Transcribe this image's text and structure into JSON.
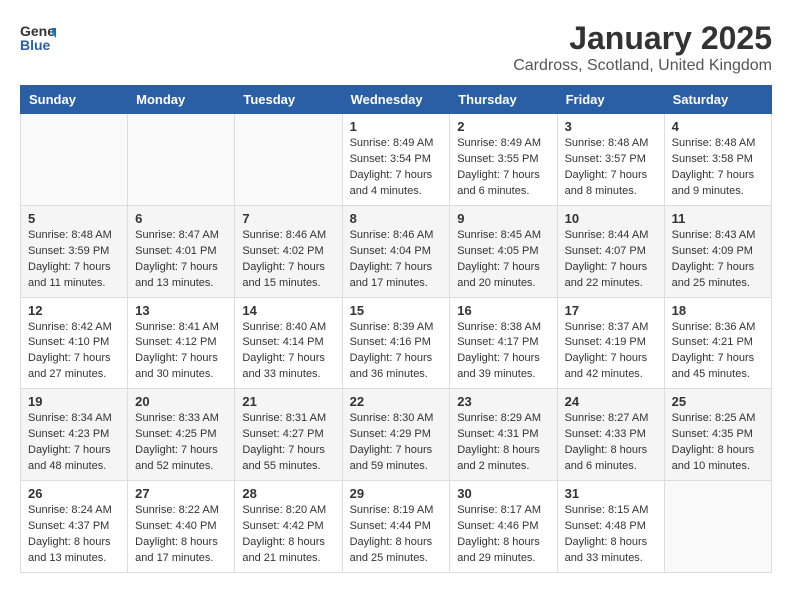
{
  "logo": {
    "text_general": "General",
    "text_blue": "Blue"
  },
  "header": {
    "month": "January 2025",
    "location": "Cardross, Scotland, United Kingdom"
  },
  "weekdays": [
    "Sunday",
    "Monday",
    "Tuesday",
    "Wednesday",
    "Thursday",
    "Friday",
    "Saturday"
  ],
  "weeks": [
    [
      {
        "day": "",
        "sunrise": "",
        "sunset": "",
        "daylight": ""
      },
      {
        "day": "",
        "sunrise": "",
        "sunset": "",
        "daylight": ""
      },
      {
        "day": "",
        "sunrise": "",
        "sunset": "",
        "daylight": ""
      },
      {
        "day": "1",
        "sunrise": "Sunrise: 8:49 AM",
        "sunset": "Sunset: 3:54 PM",
        "daylight": "Daylight: 7 hours and 4 minutes."
      },
      {
        "day": "2",
        "sunrise": "Sunrise: 8:49 AM",
        "sunset": "Sunset: 3:55 PM",
        "daylight": "Daylight: 7 hours and 6 minutes."
      },
      {
        "day": "3",
        "sunrise": "Sunrise: 8:48 AM",
        "sunset": "Sunset: 3:57 PM",
        "daylight": "Daylight: 7 hours and 8 minutes."
      },
      {
        "day": "4",
        "sunrise": "Sunrise: 8:48 AM",
        "sunset": "Sunset: 3:58 PM",
        "daylight": "Daylight: 7 hours and 9 minutes."
      }
    ],
    [
      {
        "day": "5",
        "sunrise": "Sunrise: 8:48 AM",
        "sunset": "Sunset: 3:59 PM",
        "daylight": "Daylight: 7 hours and 11 minutes."
      },
      {
        "day": "6",
        "sunrise": "Sunrise: 8:47 AM",
        "sunset": "Sunset: 4:01 PM",
        "daylight": "Daylight: 7 hours and 13 minutes."
      },
      {
        "day": "7",
        "sunrise": "Sunrise: 8:46 AM",
        "sunset": "Sunset: 4:02 PM",
        "daylight": "Daylight: 7 hours and 15 minutes."
      },
      {
        "day": "8",
        "sunrise": "Sunrise: 8:46 AM",
        "sunset": "Sunset: 4:04 PM",
        "daylight": "Daylight: 7 hours and 17 minutes."
      },
      {
        "day": "9",
        "sunrise": "Sunrise: 8:45 AM",
        "sunset": "Sunset: 4:05 PM",
        "daylight": "Daylight: 7 hours and 20 minutes."
      },
      {
        "day": "10",
        "sunrise": "Sunrise: 8:44 AM",
        "sunset": "Sunset: 4:07 PM",
        "daylight": "Daylight: 7 hours and 22 minutes."
      },
      {
        "day": "11",
        "sunrise": "Sunrise: 8:43 AM",
        "sunset": "Sunset: 4:09 PM",
        "daylight": "Daylight: 7 hours and 25 minutes."
      }
    ],
    [
      {
        "day": "12",
        "sunrise": "Sunrise: 8:42 AM",
        "sunset": "Sunset: 4:10 PM",
        "daylight": "Daylight: 7 hours and 27 minutes."
      },
      {
        "day": "13",
        "sunrise": "Sunrise: 8:41 AM",
        "sunset": "Sunset: 4:12 PM",
        "daylight": "Daylight: 7 hours and 30 minutes."
      },
      {
        "day": "14",
        "sunrise": "Sunrise: 8:40 AM",
        "sunset": "Sunset: 4:14 PM",
        "daylight": "Daylight: 7 hours and 33 minutes."
      },
      {
        "day": "15",
        "sunrise": "Sunrise: 8:39 AM",
        "sunset": "Sunset: 4:16 PM",
        "daylight": "Daylight: 7 hours and 36 minutes."
      },
      {
        "day": "16",
        "sunrise": "Sunrise: 8:38 AM",
        "sunset": "Sunset: 4:17 PM",
        "daylight": "Daylight: 7 hours and 39 minutes."
      },
      {
        "day": "17",
        "sunrise": "Sunrise: 8:37 AM",
        "sunset": "Sunset: 4:19 PM",
        "daylight": "Daylight: 7 hours and 42 minutes."
      },
      {
        "day": "18",
        "sunrise": "Sunrise: 8:36 AM",
        "sunset": "Sunset: 4:21 PM",
        "daylight": "Daylight: 7 hours and 45 minutes."
      }
    ],
    [
      {
        "day": "19",
        "sunrise": "Sunrise: 8:34 AM",
        "sunset": "Sunset: 4:23 PM",
        "daylight": "Daylight: 7 hours and 48 minutes."
      },
      {
        "day": "20",
        "sunrise": "Sunrise: 8:33 AM",
        "sunset": "Sunset: 4:25 PM",
        "daylight": "Daylight: 7 hours and 52 minutes."
      },
      {
        "day": "21",
        "sunrise": "Sunrise: 8:31 AM",
        "sunset": "Sunset: 4:27 PM",
        "daylight": "Daylight: 7 hours and 55 minutes."
      },
      {
        "day": "22",
        "sunrise": "Sunrise: 8:30 AM",
        "sunset": "Sunset: 4:29 PM",
        "daylight": "Daylight: 7 hours and 59 minutes."
      },
      {
        "day": "23",
        "sunrise": "Sunrise: 8:29 AM",
        "sunset": "Sunset: 4:31 PM",
        "daylight": "Daylight: 8 hours and 2 minutes."
      },
      {
        "day": "24",
        "sunrise": "Sunrise: 8:27 AM",
        "sunset": "Sunset: 4:33 PM",
        "daylight": "Daylight: 8 hours and 6 minutes."
      },
      {
        "day": "25",
        "sunrise": "Sunrise: 8:25 AM",
        "sunset": "Sunset: 4:35 PM",
        "daylight": "Daylight: 8 hours and 10 minutes."
      }
    ],
    [
      {
        "day": "26",
        "sunrise": "Sunrise: 8:24 AM",
        "sunset": "Sunset: 4:37 PM",
        "daylight": "Daylight: 8 hours and 13 minutes."
      },
      {
        "day": "27",
        "sunrise": "Sunrise: 8:22 AM",
        "sunset": "Sunset: 4:40 PM",
        "daylight": "Daylight: 8 hours and 17 minutes."
      },
      {
        "day": "28",
        "sunrise": "Sunrise: 8:20 AM",
        "sunset": "Sunset: 4:42 PM",
        "daylight": "Daylight: 8 hours and 21 minutes."
      },
      {
        "day": "29",
        "sunrise": "Sunrise: 8:19 AM",
        "sunset": "Sunset: 4:44 PM",
        "daylight": "Daylight: 8 hours and 25 minutes."
      },
      {
        "day": "30",
        "sunrise": "Sunrise: 8:17 AM",
        "sunset": "Sunset: 4:46 PM",
        "daylight": "Daylight: 8 hours and 29 minutes."
      },
      {
        "day": "31",
        "sunrise": "Sunrise: 8:15 AM",
        "sunset": "Sunset: 4:48 PM",
        "daylight": "Daylight: 8 hours and 33 minutes."
      },
      {
        "day": "",
        "sunrise": "",
        "sunset": "",
        "daylight": ""
      }
    ]
  ]
}
